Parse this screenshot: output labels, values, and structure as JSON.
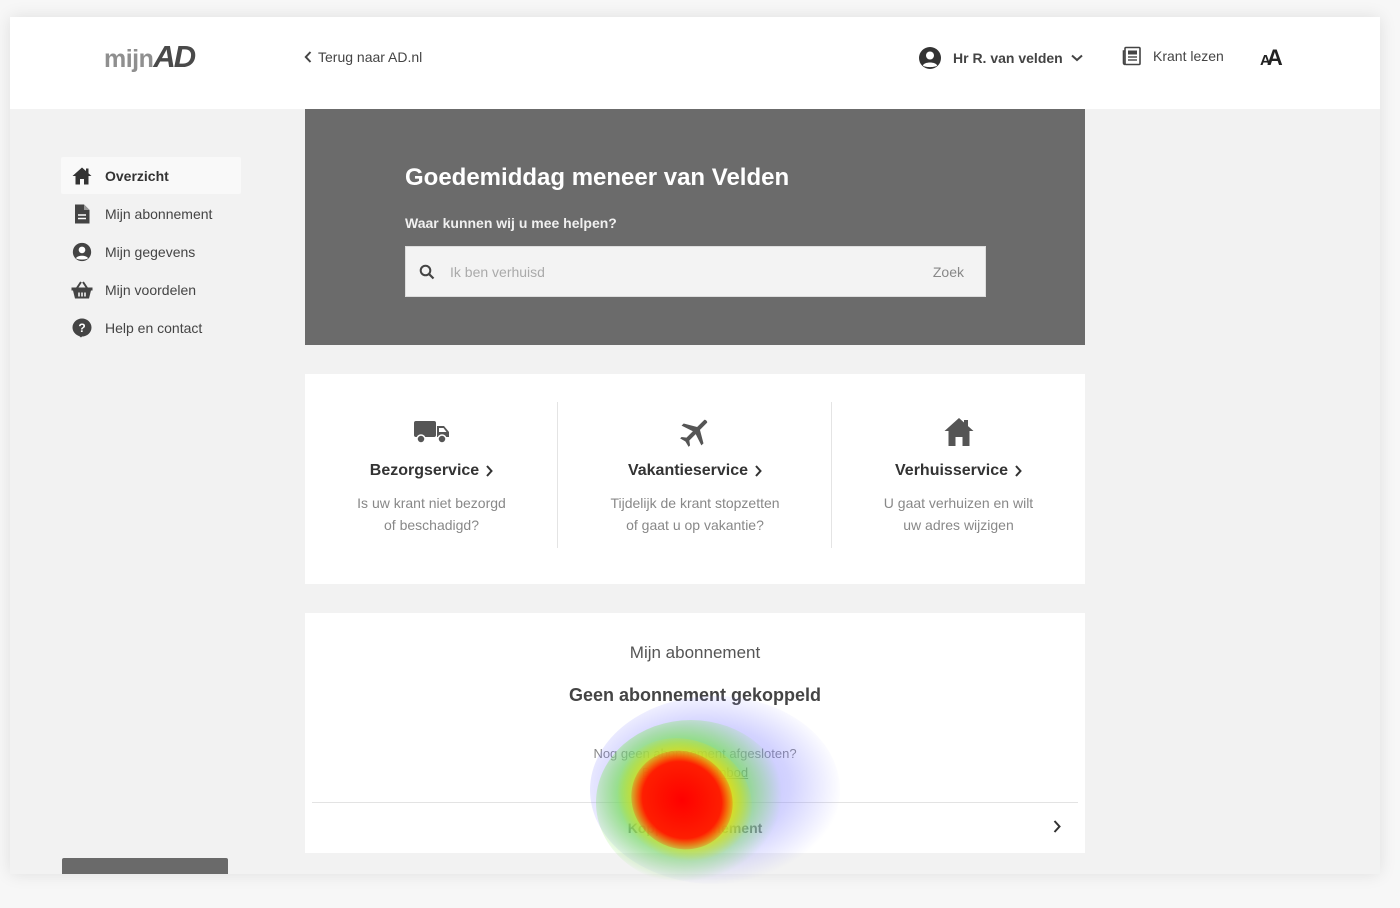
{
  "header": {
    "logo_mijn": "mijn",
    "logo_ad": "AD",
    "back_label": "Terug naar AD.nl",
    "user_label": "Hr R. van velden",
    "krant_label": "Krant lezen",
    "font_size_label_small": "A",
    "font_size_label_large": "A"
  },
  "sidebar": {
    "items": [
      {
        "label": "Overzicht",
        "icon": "home-icon"
      },
      {
        "label": "Mijn abonnement",
        "icon": "document-icon"
      },
      {
        "label": "Mijn gegevens",
        "icon": "user-icon"
      },
      {
        "label": "Mijn voordelen",
        "icon": "basket-icon"
      },
      {
        "label": "Help en contact",
        "icon": "help-icon"
      }
    ]
  },
  "hero": {
    "title": "Goedemiddag meneer van Velden",
    "subtitle": "Waar kunnen wij u mee helpen?",
    "search_placeholder": "Ik ben verhuisd",
    "search_button": "Zoek"
  },
  "services": [
    {
      "name": "Bezorgservice",
      "desc_line1": "Is uw krant niet bezorgd",
      "desc_line2": "of beschadigd?",
      "icon": "truck-icon"
    },
    {
      "name": "Vakantieservice",
      "desc_line1": "Tijdelijk de krant stopzetten",
      "desc_line2": "of gaat u op vakantie?",
      "icon": "airplane-icon"
    },
    {
      "name": "Verhuisservice",
      "desc_line1": "U gaat verhuizen en wilt",
      "desc_line2": "uw adres wijzigen",
      "icon": "house-icon"
    }
  ],
  "subscription": {
    "title": "Mijn abonnement",
    "status": "Geen abonnement gekoppeld",
    "text": "Nog geen abonnement afgesloten?",
    "offer_link": "Bekijk ons aanbod",
    "link_label": "Koppel abonnement"
  },
  "colors": {
    "hero_bg": "#6b6b6b",
    "page_bg": "#f2f2f2",
    "card_bg": "#ffffff"
  }
}
